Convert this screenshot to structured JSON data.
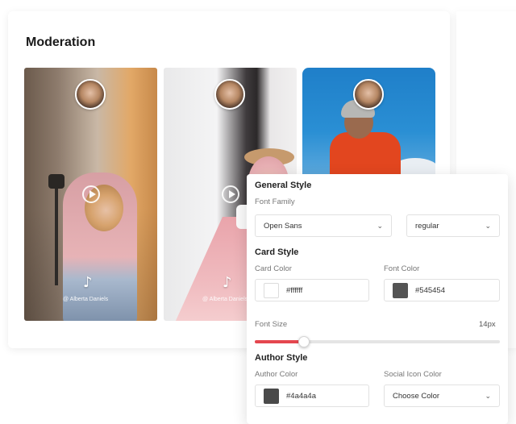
{
  "section": {
    "title": "Moderation"
  },
  "cards": [
    {
      "author": "@ Alberta Daniels",
      "play_icon": "play-circle-icon",
      "platform_icon": "tiktok-icon"
    },
    {
      "author": "@ Alberta Daniels",
      "play_icon": "play-circle-icon",
      "platform_icon": "tiktok-icon"
    },
    {
      "author": ""
    }
  ],
  "panel": {
    "general": {
      "heading": "General Style",
      "font_family_label": "Font Family",
      "font_family_value": "Open Sans",
      "font_weight_value": "regular"
    },
    "card": {
      "heading": "Card Style",
      "card_color_label": "Card Color",
      "card_color_value": "#ffffff",
      "font_color_label": "Font Color",
      "font_color_value": "#545454",
      "font_size_label": "Font Size",
      "font_size_value": "14px",
      "font_size_slider_fraction": 0.2
    },
    "author": {
      "heading": "Author Style",
      "author_color_label": "Author Color",
      "author_color_value": "#4a4a4a",
      "social_icon_color_label": "Social Icon Color",
      "social_icon_color_value": "Choose Color"
    }
  },
  "colors": {
    "accent": "#e5474f",
    "font_swatch": "#545454",
    "author_swatch": "#4a4a4a"
  }
}
